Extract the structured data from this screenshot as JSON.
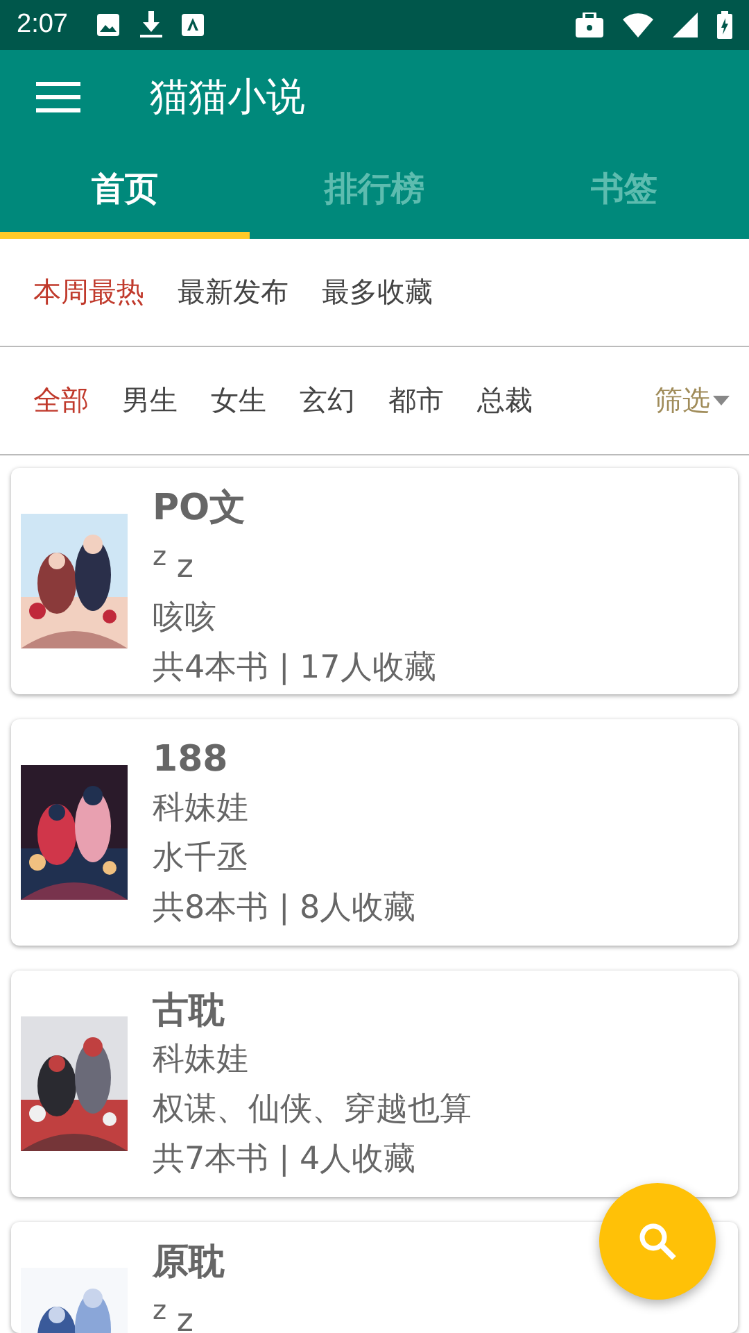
{
  "status_bar": {
    "time": "2:07"
  },
  "app_bar": {
    "title": "猫猫小说"
  },
  "tabs": [
    {
      "label": "首页",
      "selected": true
    },
    {
      "label": "排行榜",
      "selected": false
    },
    {
      "label": "书签",
      "selected": false
    }
  ],
  "sort_options": [
    {
      "label": "本周最热",
      "selected": true
    },
    {
      "label": "最新发布",
      "selected": false
    },
    {
      "label": "最多收藏",
      "selected": false
    }
  ],
  "categories": [
    {
      "label": "全部",
      "selected": true
    },
    {
      "label": "男生",
      "selected": false
    },
    {
      "label": "女生",
      "selected": false
    },
    {
      "label": "玄幻",
      "selected": false
    },
    {
      "label": "都市",
      "selected": false
    },
    {
      "label": "总裁",
      "selected": false
    }
  ],
  "filter": {
    "label": "筛选"
  },
  "booklists": [
    {
      "title": "PO文",
      "author": "$^{z}$ z",
      "description": "咳咳",
      "stats": "共4本书 | 17人收藏"
    },
    {
      "title": "188",
      "author": "科妹娃",
      "description": "水千丞",
      "stats": "共8本书 | 8人收藏"
    },
    {
      "title": "古耽",
      "author": "科妹娃",
      "description": "权谋、仙侠、穿越也算",
      "stats": "共7本书 | 4人收藏"
    },
    {
      "title": "原耽",
      "author": "$^{z}$ z"
    }
  ]
}
